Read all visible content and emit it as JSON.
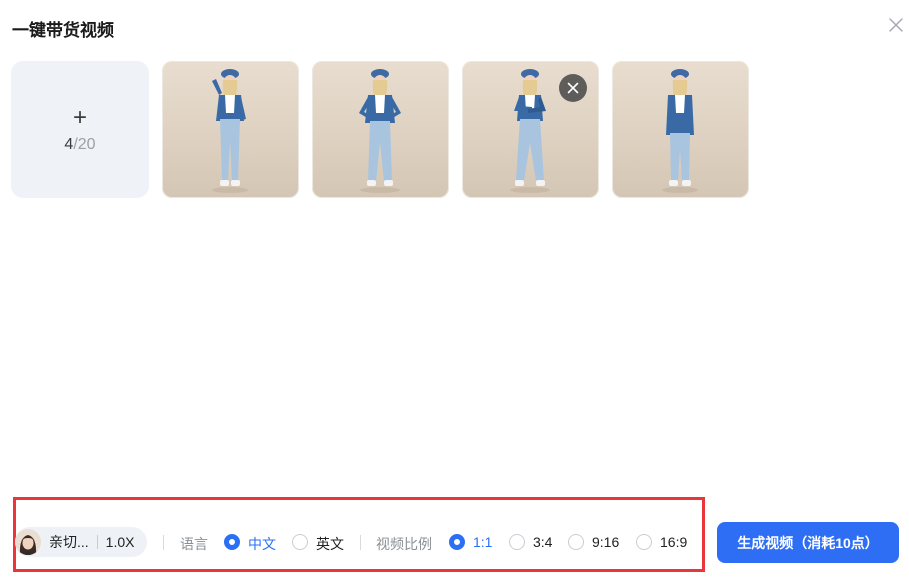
{
  "dialog": {
    "title": "一键带货视频",
    "close_icon": "close-icon"
  },
  "upload": {
    "plus": "+",
    "count": "4",
    "separator": "/",
    "max": "20",
    "icon": "plus-icon"
  },
  "images": [
    {
      "name": "model-photo-1",
      "remove_visible": false
    },
    {
      "name": "model-photo-2",
      "remove_visible": false
    },
    {
      "name": "model-photo-3",
      "remove_visible": true
    },
    {
      "name": "model-photo-4",
      "remove_visible": false
    }
  ],
  "settings": {
    "voice": {
      "name": "亲切...",
      "speed": "1.0X"
    },
    "language": {
      "label": "语言",
      "options": [
        {
          "label": "中文",
          "selected": true
        },
        {
          "label": "英文",
          "selected": false
        }
      ]
    },
    "ratio": {
      "label": "视频比例",
      "options": [
        {
          "label": "1:1",
          "selected": true
        },
        {
          "label": "3:4",
          "selected": false
        },
        {
          "label": "9:16",
          "selected": false
        },
        {
          "label": "16:9",
          "selected": false
        }
      ]
    }
  },
  "generate_button": {
    "label": "生成视频（消耗10点）"
  },
  "colors": {
    "accent": "#2e6ef5",
    "highlight_border": "#e8363b",
    "upload_bg": "#eff3f8"
  }
}
